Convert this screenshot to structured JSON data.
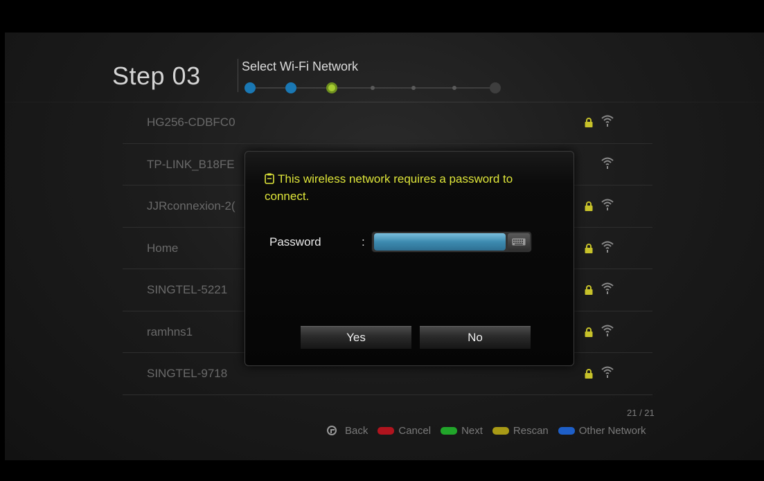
{
  "header": {
    "step": "Step 03",
    "subtitle": "Select Wi-Fi Network",
    "progress": {
      "total_steps": 7,
      "current_step": 3,
      "completed": 2
    }
  },
  "networks": [
    {
      "name": "HG256-CDBFC0",
      "locked": true
    },
    {
      "name": "TP-LINK_B18FE",
      "locked": false
    },
    {
      "name": "JJRconnexion-2(",
      "locked": true
    },
    {
      "name": "Home",
      "locked": true
    },
    {
      "name": "SINGTEL-5221",
      "locked": true
    },
    {
      "name": "ramhns1",
      "locked": true
    },
    {
      "name": "SINGTEL-9718",
      "locked": true
    }
  ],
  "counter": "21 / 21",
  "footer": {
    "back": "Back",
    "cancel": "Cancel",
    "next": "Next",
    "rescan": "Rescan",
    "other": "Other Network",
    "colors": {
      "cancel": "#b0141e",
      "next": "#21a52a",
      "rescan": "#a89a16",
      "other": "#1e5fc8"
    }
  },
  "dialog": {
    "message": "This wireless network requires a password to connect.",
    "password_label": "Password",
    "colon": ":",
    "password_value": "",
    "yes": "Yes",
    "no": "No"
  },
  "colors": {
    "accent_yellow": "#dfe63a",
    "lock": "#c7c22a",
    "wifi": "#8a8a8a",
    "progress_done": "#1a78b4",
    "progress_current": "#8fb52a"
  }
}
